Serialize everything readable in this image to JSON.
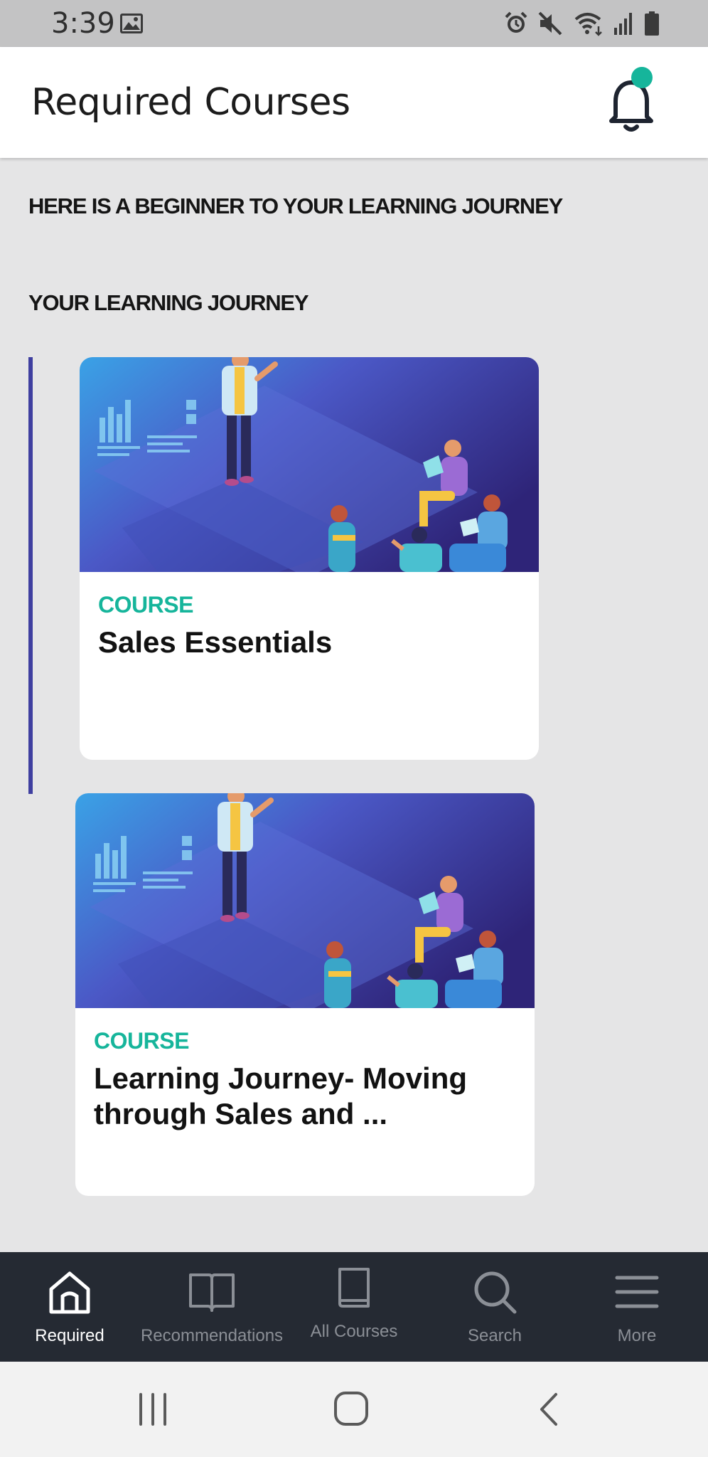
{
  "status_bar": {
    "time": "3:39",
    "icons": [
      "image-icon",
      "alarm-icon",
      "mute-icon",
      "wifi-icon",
      "signal-icon",
      "battery-icon"
    ]
  },
  "header": {
    "title": "Required Courses",
    "notification_icon": "bell-icon",
    "badge_color": "#16b59b"
  },
  "main": {
    "intro": "HERE IS A BEGINNER TO YOUR LEARNING JOURNEY",
    "journey_heading": "YOUR LEARNING JOURNEY",
    "courses": [
      {
        "type": "COURSE",
        "title": "Sales Essentials"
      },
      {
        "type": "COURSE",
        "title": "Learning Journey- Moving through Sales  and ..."
      }
    ]
  },
  "bottom_nav": {
    "items": [
      {
        "label": "Required",
        "icon": "home-icon",
        "active": true
      },
      {
        "label": "Recommendations",
        "icon": "book-open-icon",
        "active": false
      },
      {
        "label": "All Courses",
        "icon": "book-icon",
        "active": false
      },
      {
        "label": "Search",
        "icon": "search-icon",
        "active": false
      },
      {
        "label": "More",
        "icon": "menu-icon",
        "active": false
      }
    ]
  },
  "system_nav": {
    "icons": [
      "recents-icon",
      "home-button-icon",
      "back-icon"
    ]
  },
  "colors": {
    "accent": "#16b59b",
    "journey_line": "#3f3fa0",
    "nav_background": "#252a33"
  }
}
